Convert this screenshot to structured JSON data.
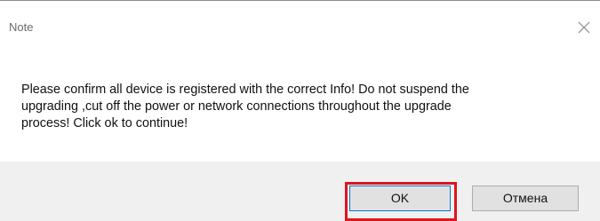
{
  "window": {
    "title": "Note",
    "close_icon": "close-icon"
  },
  "message": {
    "line1": "Please confirm all device is registered with the correct Info! Do not suspend the",
    "line2": "upgrading ,cut off the power or network connections throughout the upgrade",
    "line3": "process! Click ok to continue!"
  },
  "buttons": {
    "ok_label": "OK",
    "cancel_label": "Отмена"
  },
  "colors": {
    "highlight": "#e0141e",
    "focus_border": "#0078d7",
    "footer_bg": "#f0f0f0"
  }
}
